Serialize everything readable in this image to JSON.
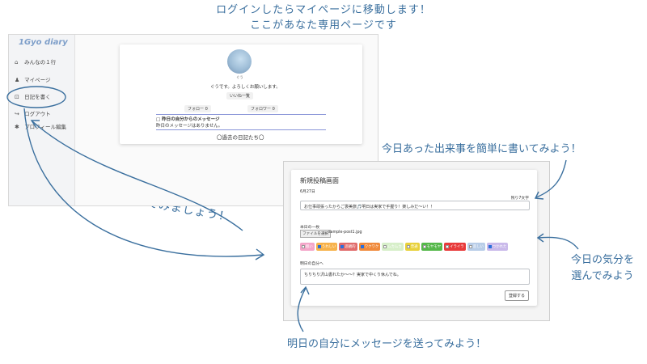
{
  "annotations": {
    "top_line1": "ログインしたらマイページに移動します！",
    "top_line2": "ここがあなた専用ページです",
    "right1": "今日あった出来事を簡単に書いてみよう！",
    "right2_line1": "今日の気分を",
    "right2_line2": "選んでみよう",
    "bottom": "明日の自分にメッセージを送ってみよう！",
    "diagonal": "早速日記を書いてみましょう！"
  },
  "mypage": {
    "logo": "1Gyo diary",
    "nav": [
      {
        "icon": "home-icon",
        "glyph": "⌂",
        "label": "みんなの１行"
      },
      {
        "icon": "user-icon",
        "glyph": "♟",
        "label": "マイページ"
      },
      {
        "icon": "edit-icon",
        "glyph": "⊡",
        "label": "日記を書く"
      },
      {
        "icon": "logout-icon",
        "glyph": "↪",
        "label": "ログアウト"
      },
      {
        "icon": "gear-icon",
        "glyph": "✱",
        "label": "プロフィール編集"
      }
    ],
    "username": "ぐう",
    "greeting": "ぐうです。よろしくお願いします。",
    "likes_button": "いいね一覧",
    "follow_label": "フォロー  0",
    "follower_label": "フォロワー  0",
    "message_heading": "□ 昨日の自分からのメッセージ",
    "message_body": "昨日のメッセージはありません。",
    "past_diaries": "〇過去の日記たち〇"
  },
  "new_post": {
    "title": "新規投稿画面",
    "date": "6月27日",
    "remaining": "残り7文字",
    "diary_text": "お仕事頑張ったからご褒美旅🎵明日は実家で手握り！楽しみだ〜い！！",
    "photo_label": "本日の一枚",
    "file_button": "ファイルを選択",
    "file_name": "sample-post1.jpg",
    "moods": [
      {
        "label": "眠い",
        "color": "#f4a6c9",
        "checked": false
      },
      {
        "label": "うれしい",
        "color": "#f7b24a",
        "checked": true
      },
      {
        "label": "悲観的",
        "color": "#e06b6b",
        "checked": true
      },
      {
        "label": "ワクワク",
        "color": "#f08a3c",
        "checked": true
      },
      {
        "label": "ムカムカ",
        "color": "#d7efc9",
        "checked": false
      },
      {
        "label": "普通",
        "color": "#e8d13a",
        "checked": false
      },
      {
        "label": "モヤモヤ",
        "color": "#55b84a",
        "checked": false
      },
      {
        "label": "イライラ",
        "color": "#e83a3a",
        "checked": false
      },
      {
        "label": "悲しい",
        "color": "#b8cde8",
        "checked": false
      },
      {
        "label": "つかれた",
        "color": "#c9b9ea",
        "checked": true
      }
    ],
    "message_label": "明日の自分へ",
    "message_text": "ちりちり沢山書れたか〜〜？実家で中くり休んでね。",
    "submit": "登録する"
  }
}
